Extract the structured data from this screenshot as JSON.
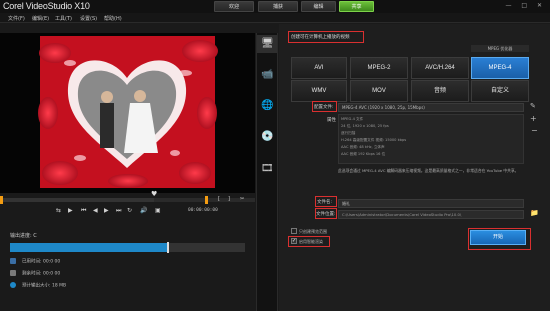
{
  "app": {
    "title": "Corel VideoStudio X10"
  },
  "top_tabs": [
    "欢迎",
    "捕获",
    "编辑",
    "共享"
  ],
  "menu": [
    "文件(F)",
    "编辑(E)",
    "工具(T)",
    "设置(S)",
    "帮助(H)"
  ],
  "player": {
    "timecode": "00:00:00:00"
  },
  "render": {
    "label": "输出进度: C",
    "progress": 0.672,
    "stats": [
      {
        "label": "已用时间",
        "value": "00:0 00",
        "color": "#3a6ea5"
      },
      {
        "label": "剩余时间",
        "value": "00:0 00",
        "color": "#7a7a7a"
      },
      {
        "label": "预计输出大小",
        "value": "18 MB",
        "color": "#1e88c8"
      }
    ]
  },
  "share": {
    "heading": "创建可在计算机上播放的视频",
    "format_header": "MPEG 优化器",
    "formats": [
      "AVI",
      "MPEG-2",
      "AVC/H.264",
      "MPEG-4",
      "WMV",
      "MOV",
      "音频",
      "自定义"
    ],
    "selected_format": "MPEG-4",
    "profile_label": "配置文件:",
    "profile_value": "MPEG-4 AVC (1920 x 1080, 25p, 15Mbps)",
    "properties_label": "属性",
    "properties": [
      "MPEG-4 文件",
      "24 位, 1920 x 1080, 25 fps",
      "逐行扫描",
      "H.264 高级配置文件 视频: 15000 kbps",
      "AAC 音频: 48 kHz, 立体声",
      "AAC 音频 192 Kbps 16 位"
    ],
    "description": "此选项会通过 MPEG-4 AVC 编解码器来压缩视频。这是最高质量格式之一，非常适合在 YouTube 中共享。",
    "filename_label": "文件名:",
    "filename_value": "婚礼",
    "filepath_label": "文件位置:",
    "filepath_value": "C:\\Users\\Administrator\\Documents\\Corel VideoStudio Pro\\10.0\\",
    "check1": "只创建预览范围",
    "check2": "启用智能渲染",
    "start_button": "开始"
  }
}
